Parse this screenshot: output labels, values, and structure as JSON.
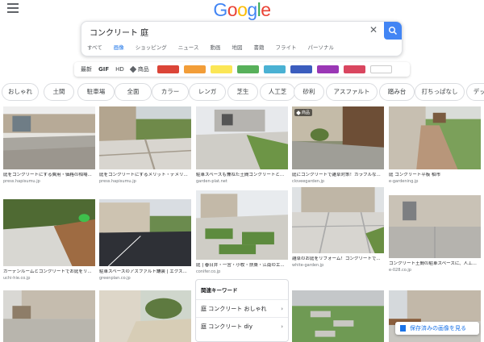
{
  "header": {
    "logo": [
      {
        "ch": "G",
        "color": "#4285f4"
      },
      {
        "ch": "o",
        "color": "#ea4335"
      },
      {
        "ch": "o",
        "color": "#fbbc05"
      },
      {
        "ch": "g",
        "color": "#4285f4"
      },
      {
        "ch": "l",
        "color": "#34a853"
      },
      {
        "ch": "e",
        "color": "#ea4335"
      }
    ]
  },
  "search": {
    "query": "コンクリート 庭",
    "clear_icon": "close-icon",
    "search_icon": "search-icon"
  },
  "tabs": [
    "すべて",
    "画像",
    "ショッピング",
    "ニュース",
    "動画",
    "地図",
    "書籍",
    "フライト",
    "パーソナル"
  ],
  "active_tab": 1,
  "tools": {
    "recent": "最新",
    "gif": "GIF",
    "hd": "HD",
    "products": "商品"
  },
  "color_swatches": [
    "#db4437",
    "#f29d38",
    "#fbe655",
    "#57b05a",
    "#4ab1d3",
    "#3b5dbe",
    "#9a37b5",
    "#d9465f",
    "#ffffff"
  ],
  "chips": [
    "おしゃれ",
    "土間",
    "駐車場",
    "全面",
    "カラー",
    "レンガ",
    "芝生",
    "人工芝",
    "砂利",
    "アスファルト",
    "踏み台",
    "打ちっぱなし",
    "デッキ"
  ],
  "results": [
    {
      "caption": "庭をコンクリートにする費用・価格の相場...",
      "source": "press.hapisumu.jp",
      "badge": ""
    },
    {
      "caption": "庭をコンクリートにするメリット・デメリ...",
      "source": "press.hapisumu.jp",
      "badge": ""
    },
    {
      "caption": "駐車スペースも兼ねた土間コンクリートと...",
      "source": "garden-plat.net",
      "badge": ""
    },
    {
      "caption": "庭にコンクリートで雑草対策！カラフルな...",
      "source": "cloveegarden.jp",
      "badge": "商品"
    },
    {
      "caption": "庭 コンクリート平板 柏市",
      "source": "e-gardening.jp",
      "badge": ""
    },
    {
      "caption": "ガーデンルームとコンクリートでお庭をリ...",
      "source": "uchi-hie.co.jp",
      "badge": ""
    },
    {
      "caption": "駐車スペースのアスファルト舗装 | エクス...",
      "source": "greenplan.co.jp",
      "badge": ""
    },
    {
      "caption": "庭 | 春日井・一宮・小牧・扶桑・江南のエ...",
      "source": "conifer.co.jp",
      "badge": ""
    },
    {
      "caption": "雑草のお庭をリフォーム！コンクリートで...",
      "source": "white-garden.jp",
      "badge": ""
    },
    {
      "caption": "コンクリート土間の駐車スペースに、人工...",
      "source": "e-028.co.jp",
      "badge": ""
    },
    {
      "caption": "",
      "source": "",
      "badge": ""
    },
    {
      "caption": "",
      "source": "",
      "badge": ""
    },
    {
      "caption": "",
      "source": "",
      "badge": ""
    },
    {
      "caption": "",
      "source": "",
      "badge": ""
    }
  ],
  "related": {
    "title": "関連キーワード",
    "items": [
      "庭 コンクリート おしゃれ",
      "庭 コンクリート diy"
    ]
  },
  "saved": {
    "label": "保存済みの画像を見る",
    "icon": "bookmark-icon"
  }
}
